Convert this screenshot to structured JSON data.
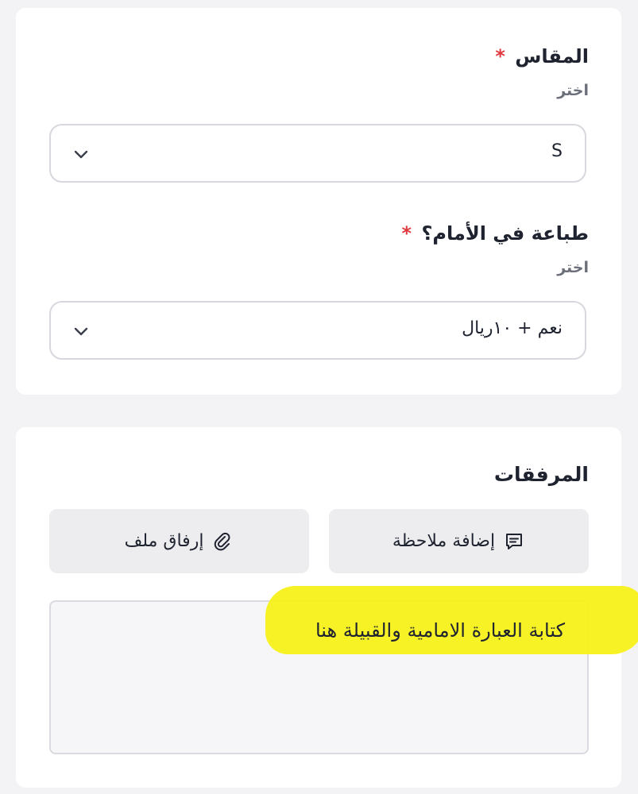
{
  "size_field": {
    "label": "المقاس",
    "required_mark": "*",
    "hint": "اختر",
    "selected_value": "S"
  },
  "print_field": {
    "label": "طباعة في الأمام؟",
    "required_mark": "*",
    "hint": "اختر",
    "selected_value": "نعم + ١٠ريال"
  },
  "attachments": {
    "title": "المرفقات",
    "add_note_label": "إضافة ملاحظة",
    "attach_file_label": "إرفاق ملف",
    "note_text": "كتابة العبارة الامامية والقبيلة هنا"
  },
  "colors": {
    "required": "#e0393e",
    "highlight": "#f5f11a",
    "button_bg": "#ededf0",
    "border": "#d6d8dd"
  },
  "icons": {
    "select_chevron": "chevron-down-icon",
    "add_note": "note-icon",
    "attach_file": "paperclip-icon"
  }
}
